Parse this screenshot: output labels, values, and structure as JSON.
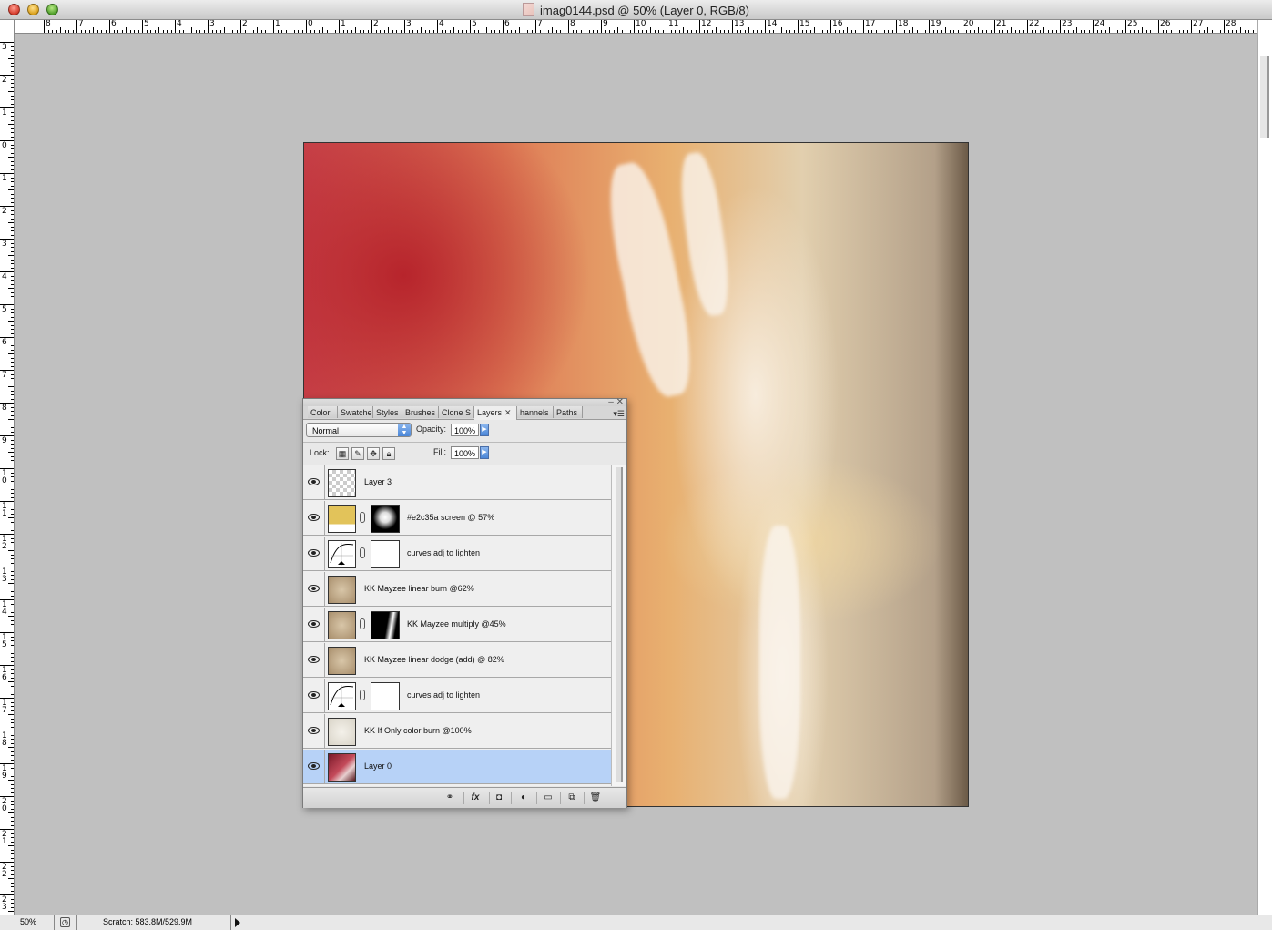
{
  "window": {
    "title": "imag0144.psd @ 50% (Layer 0, RGB/8)"
  },
  "rulers": {
    "top": [
      "8",
      "7",
      "6",
      "5",
      "4",
      "3",
      "2",
      "1",
      "0",
      "1",
      "2",
      "3",
      "4",
      "5",
      "6",
      "7",
      "8",
      "9",
      "10",
      "11",
      "12",
      "13",
      "14",
      "15",
      "16",
      "17",
      "18",
      "19",
      "20",
      "21",
      "22",
      "23",
      "24",
      "25",
      "26",
      "27",
      "28"
    ],
    "left": [
      "3",
      "2",
      "1",
      "0",
      "1",
      "2",
      "3",
      "4",
      "5",
      "6",
      "7",
      "8",
      "9",
      "10",
      "11",
      "12",
      "13",
      "14",
      "15",
      "16",
      "17",
      "18",
      "19",
      "20",
      "21",
      "22",
      "23"
    ]
  },
  "panel": {
    "tabs": [
      "Color",
      "Swatche",
      "Styles",
      "Brushes",
      "Clone S",
      "Layers",
      "hannels",
      "Paths"
    ],
    "active_tab": "Layers",
    "blend_mode": "Normal",
    "opacity_label": "Opacity:",
    "opacity_value": "100%",
    "lock_label": "Lock:",
    "fill_label": "Fill:",
    "fill_value": "100%",
    "layers": [
      {
        "name": "Layer 3",
        "thumb": "transparent",
        "mask": null,
        "selected": false
      },
      {
        "name": "#e2c35a  screen @ 57%",
        "thumb": "fill-yellow",
        "mask": "radial",
        "selected": false
      },
      {
        "name": "curves adj to lighten",
        "thumb": "curves",
        "mask": "white",
        "selected": false
      },
      {
        "name": "KK Mayzee linear burn @62%",
        "thumb": "texture",
        "mask": null,
        "selected": false
      },
      {
        "name": "KK Mayzee multiply @45%",
        "thumb": "texture",
        "mask": "black",
        "selected": false
      },
      {
        "name": "KK Mayzee linear dodge (add) @ 82%",
        "thumb": "texture",
        "mask": null,
        "selected": false
      },
      {
        "name": "curves adj to lighten",
        "thumb": "curves",
        "mask": "white",
        "selected": false
      },
      {
        "name": "KK If Only color burn @100%",
        "thumb": "light",
        "mask": null,
        "selected": false
      },
      {
        "name": "Layer 0",
        "thumb": "photo",
        "mask": null,
        "selected": true
      }
    ],
    "bottom_buttons": [
      "link-icon",
      "fx",
      "mask-icon",
      "adjustment-icon",
      "folder-icon",
      "new-layer-icon",
      "trash-icon"
    ],
    "fx_label": "fx"
  },
  "status": {
    "zoom": "50%",
    "scratch": "Scratch: 583.8M/529.9M"
  },
  "colors": {
    "selected_row": "#b7d2f7",
    "fill_layer": "#e2c35a"
  }
}
